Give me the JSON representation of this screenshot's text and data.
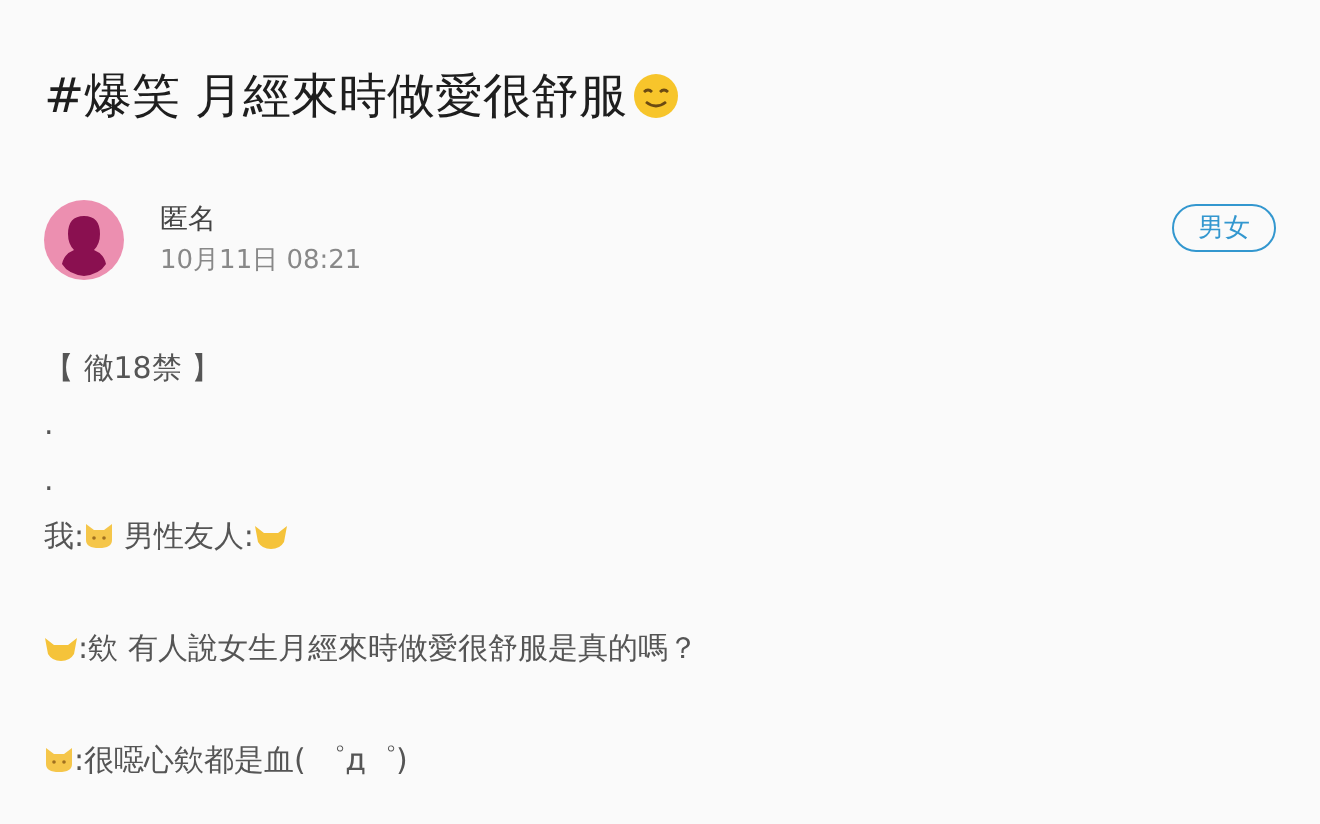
{
  "post": {
    "title": [
      {
        "kind": "text",
        "text": "#爆笑 月經來時做愛很舒服"
      },
      {
        "kind": "smile"
      }
    ],
    "author": "匿名",
    "time": "10月11日 08:21",
    "forum_tag": "男女"
  },
  "paragraphs": [
    {
      "lines": [
        [
          {
            "kind": "text",
            "text": "【 徹18禁 】"
          }
        ],
        [
          {
            "kind": "text",
            "text": "."
          }
        ],
        [
          {
            "kind": "text",
            "text": "."
          }
        ],
        [
          {
            "kind": "text",
            "text": "我:"
          },
          {
            "kind": "cat-face"
          },
          {
            "kind": "text",
            "text": " 男性友人:"
          },
          {
            "kind": "cat-head"
          }
        ]
      ]
    },
    {
      "lines": [
        [
          {
            "kind": "cat-head"
          },
          {
            "kind": "text",
            "text": ":欸 有人說女生月經來時做愛很舒服是真的嗎？"
          }
        ]
      ]
    },
    {
      "lines": [
        [
          {
            "kind": "cat-face"
          },
          {
            "kind": "text",
            "text": ":很噁心欸都是血( ゜д゜)"
          }
        ]
      ]
    }
  ]
}
